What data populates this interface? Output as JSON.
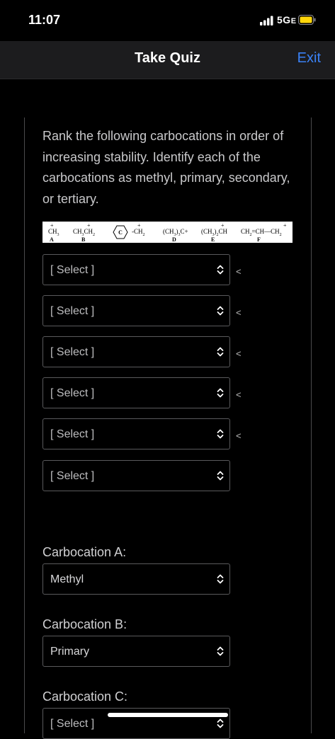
{
  "status_bar": {
    "time": "11:07",
    "network": "5G",
    "network_sub": "E"
  },
  "nav": {
    "title": "Take Quiz",
    "exit_label": "Exit"
  },
  "question": {
    "text": "Rank the following carbocations in order of increasing stability.  Identify each of the carbocations as methyl, primary, secondary, or tertiary."
  },
  "structures": [
    {
      "formula": "CH3 +",
      "label": "A"
    },
    {
      "formula": "CH3CH2 +",
      "label": "B"
    },
    {
      "formula": "C6H5-CH2 +",
      "label": "C"
    },
    {
      "formula": "(CH3)3C+",
      "label": "D"
    },
    {
      "formula": "(CH3)2CH +",
      "label": "E"
    },
    {
      "formula": "CH2=CH-CH2 +",
      "label": "F"
    }
  ],
  "ranking": {
    "selects": [
      "[ Select ]",
      "[ Select ]",
      "[ Select ]",
      "[ Select ]",
      "[ Select ]",
      "[ Select ]"
    ],
    "separator": "<"
  },
  "carbocations": [
    {
      "label": "Carbocation A:",
      "value": "Methyl"
    },
    {
      "label": "Carbocation B:",
      "value": "Primary"
    },
    {
      "label": "Carbocation C:",
      "value": "[ Select ]"
    }
  ]
}
